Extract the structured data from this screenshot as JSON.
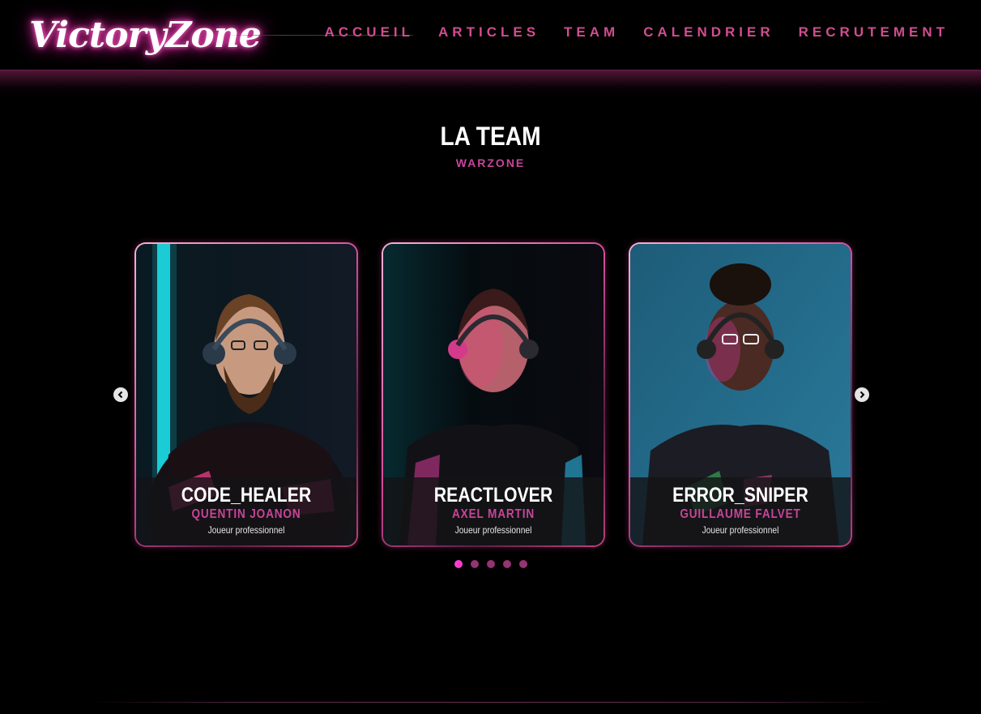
{
  "brand": {
    "logo_text": "VictoryZone",
    "accent": "#c8449a",
    "glow": "#ff3cb4"
  },
  "nav": {
    "items": [
      {
        "label": "ACCUEIL"
      },
      {
        "label": "ARTICLES"
      },
      {
        "label": "TEAM"
      },
      {
        "label": "CALENDRIER"
      },
      {
        "label": "RECRUTEMENT"
      }
    ]
  },
  "section": {
    "title": "LA TEAM",
    "subtitle": "WARZONE"
  },
  "carousel": {
    "prev_icon": "chevron-left-icon",
    "next_icon": "chevron-right-icon",
    "cards": [
      {
        "pseudo": "CODE_HEALER",
        "name": "QUENTIN JOANON",
        "role": "Joueur professionnel"
      },
      {
        "pseudo": "REACTLOVER",
        "name": "AXEL MARTIN",
        "role": "Joueur professionnel"
      },
      {
        "pseudo": "ERROR_SNIPER",
        "name": "GUILLAUME FALVET",
        "role": "Joueur professionnel"
      }
    ],
    "page_count": 5,
    "active_page": 1
  }
}
